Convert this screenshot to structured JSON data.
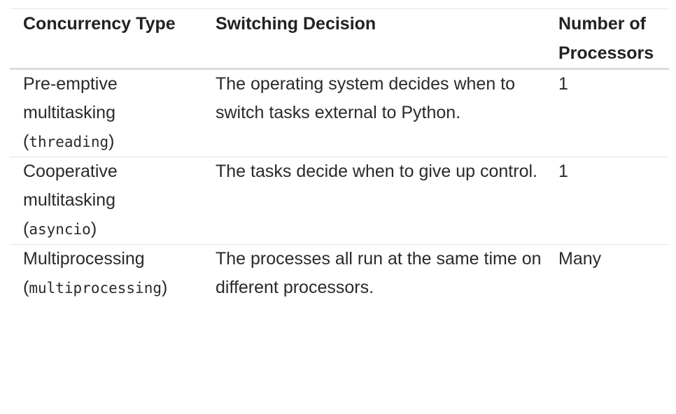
{
  "table": {
    "headers": [
      "Concurrency Type",
      "Switching Decision",
      "Number of Processors"
    ],
    "rows": [
      {
        "type_line1": "Pre-emptive",
        "type_line2": "multitasking",
        "type_module": "threading",
        "decision": "The operating system decides when to switch tasks external to Python.",
        "processors": "1"
      },
      {
        "type_line1": "Cooperative",
        "type_line2": "multitasking",
        "type_module": "asyncio",
        "decision": "The tasks decide when to give up control.",
        "processors": "1"
      },
      {
        "type_line1": "Multiprocessing",
        "type_module": "multiprocessing",
        "decision": "The processes all run at the same time on different processors.",
        "processors": "Many"
      }
    ]
  }
}
